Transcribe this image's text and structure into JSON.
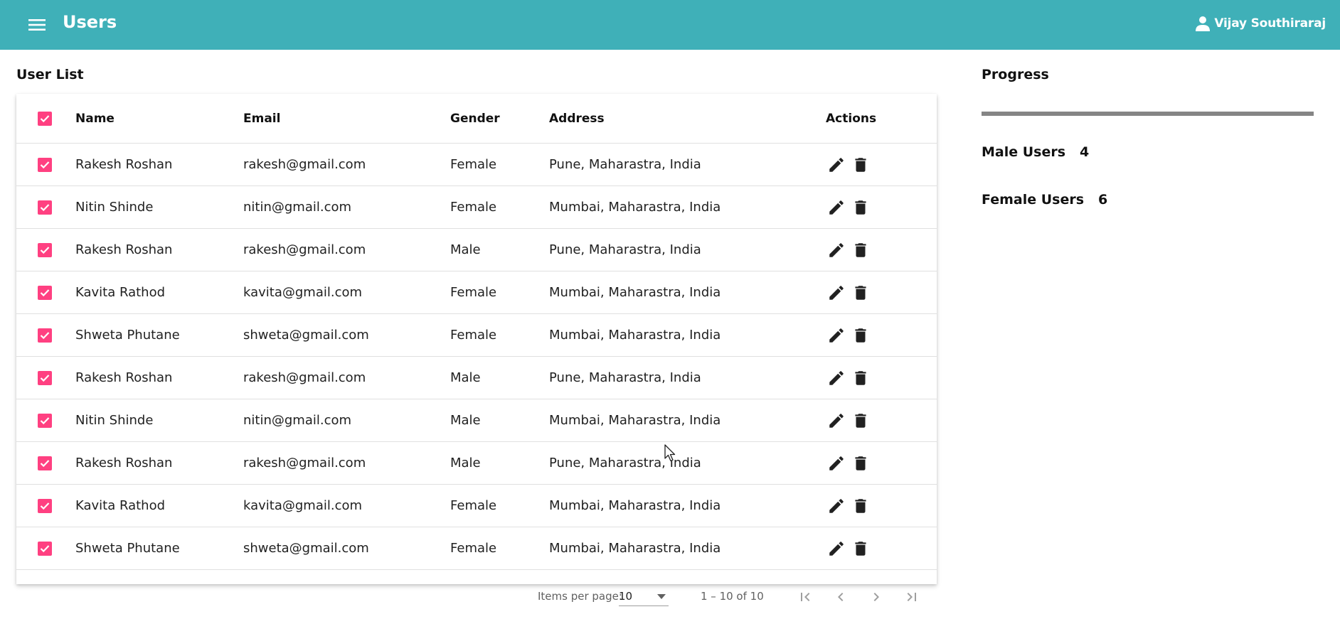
{
  "header": {
    "title": "Users",
    "user_name": "Vijay Southiraraj",
    "bg_color": "#3fb0b8"
  },
  "user_list": {
    "title": "User List",
    "columns": {
      "name": "Name",
      "email": "Email",
      "gender": "Gender",
      "address": "Address",
      "actions": "Actions"
    },
    "rows": [
      {
        "name": "Rakesh Roshan",
        "email": "rakesh@gmail.com",
        "gender": "Female",
        "address": "Pune, Maharastra, India"
      },
      {
        "name": "Nitin Shinde",
        "email": "nitin@gmail.com",
        "gender": "Female",
        "address": "Mumbai, Maharastra, India"
      },
      {
        "name": "Rakesh Roshan",
        "email": "rakesh@gmail.com",
        "gender": "Male",
        "address": "Pune, Maharastra, India"
      },
      {
        "name": "Kavita Rathod",
        "email": "kavita@gmail.com",
        "gender": "Female",
        "address": "Mumbai, Maharastra, India"
      },
      {
        "name": "Shweta Phutane",
        "email": "shweta@gmail.com",
        "gender": "Female",
        "address": "Mumbai, Maharastra, India"
      },
      {
        "name": "Rakesh Roshan",
        "email": "rakesh@gmail.com",
        "gender": "Male",
        "address": "Pune, Maharastra, India"
      },
      {
        "name": "Nitin Shinde",
        "email": "nitin@gmail.com",
        "gender": "Male",
        "address": "Mumbai, Maharastra, India"
      },
      {
        "name": "Rakesh Roshan",
        "email": "rakesh@gmail.com",
        "gender": "Male",
        "address": "Pune, Maharastra, India"
      },
      {
        "name": "Kavita Rathod",
        "email": "kavita@gmail.com",
        "gender": "Female",
        "address": "Mumbai, Maharastra, India"
      },
      {
        "name": "Shweta Phutane",
        "email": "shweta@gmail.com",
        "gender": "Female",
        "address": "Mumbai, Maharastra, India"
      }
    ],
    "checkbox_color": "#ff4081"
  },
  "paginator": {
    "items_per_page_label": "Items per page:",
    "items_per_page_value": "10",
    "range_label": "1 – 10 of 10"
  },
  "side": {
    "progress_title": "Progress",
    "male_label": "Male Users",
    "male_count": "4",
    "female_label": "Female Users",
    "female_count": "6"
  }
}
